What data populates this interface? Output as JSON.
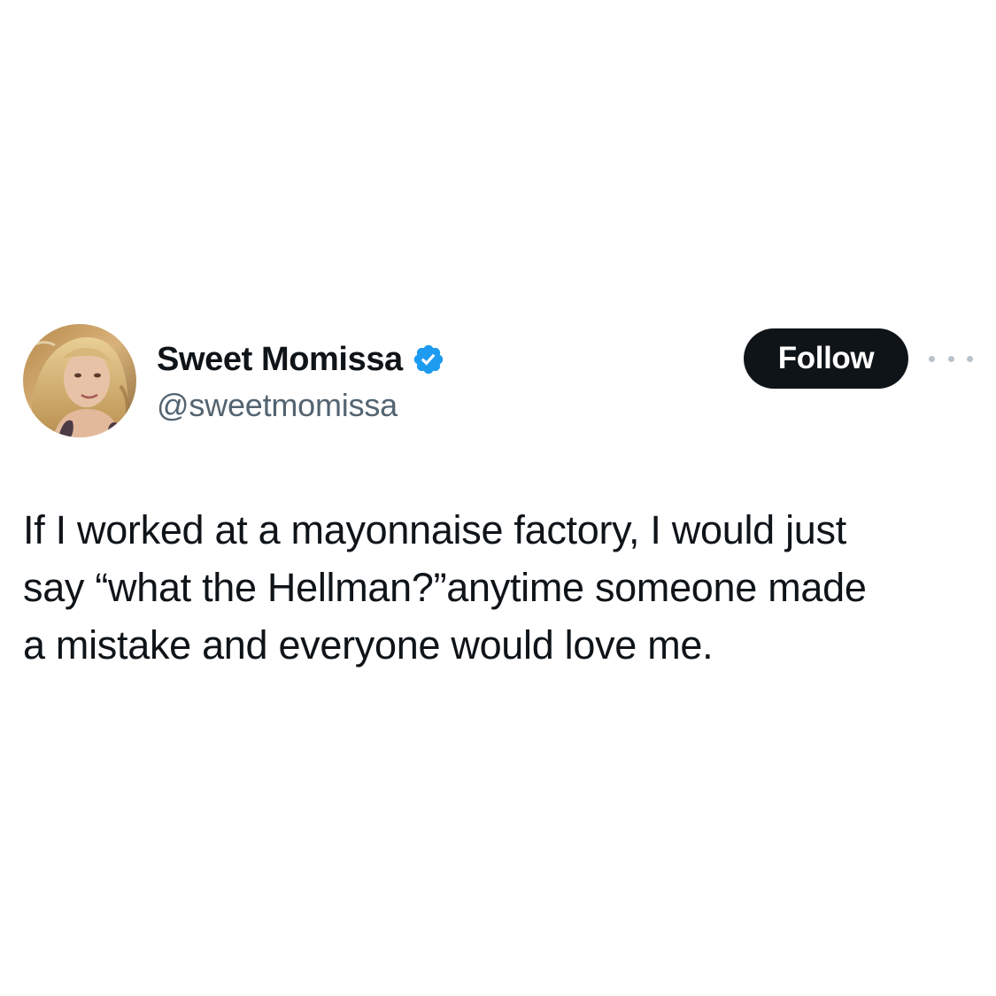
{
  "author": {
    "display_name": "Sweet Momissa",
    "handle": "@sweetmomissa",
    "verified": true,
    "verified_color": "#1d9bf0",
    "avatar_icon": "profile-photo"
  },
  "actions": {
    "follow_label": "Follow",
    "more_icon": "more-options-icon"
  },
  "tweet": {
    "text": "If I worked at a mayonnaise factory, I would just\nsay “what the Hellman?”anytime someone made\na mistake and everyone would love me."
  },
  "colors": {
    "text_primary": "#0f1419",
    "text_secondary": "#536471",
    "follow_button_bg": "#0f1419",
    "follow_button_text": "#ffffff"
  }
}
